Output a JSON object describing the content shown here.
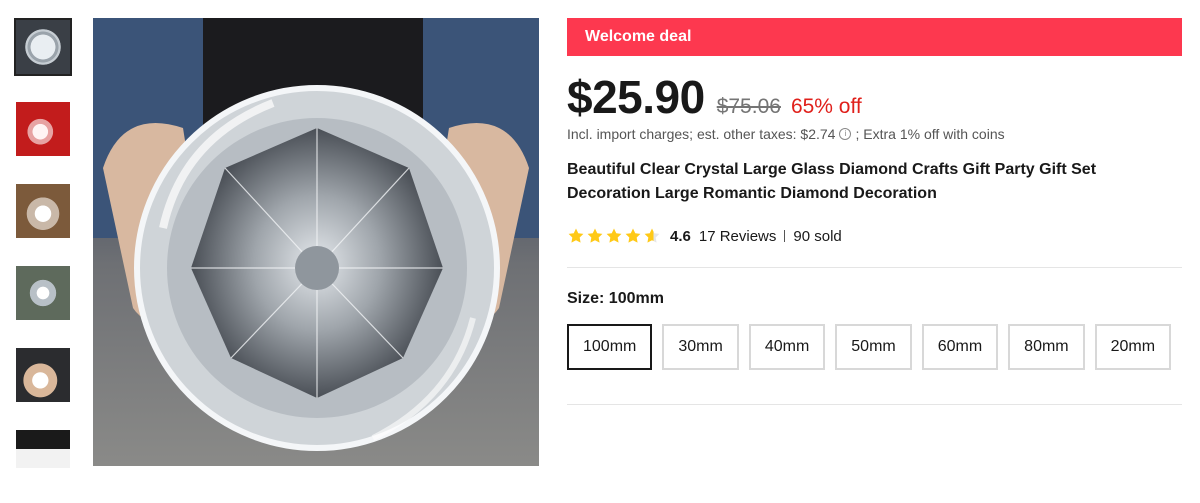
{
  "banner": {
    "label": "Welcome deal",
    "color": "#fd384f"
  },
  "price": {
    "current": "$25.90",
    "original": "$75.06",
    "discount": "65% off"
  },
  "tax_note": {
    "before": "Incl. import charges; est. other taxes: $2.74",
    "info_icon": "info-icon",
    "after": "; Extra 1% off with coins"
  },
  "product": {
    "title": "Beautiful Clear Crystal Large Glass Diamond Crafts Gift Party Gift Set Decoration Large Romantic Diamond Decoration"
  },
  "rating": {
    "score": "4.6",
    "stars_value": 4.6,
    "star_color": "#ffc917",
    "reviews": "17 Reviews",
    "sold": "90 sold"
  },
  "size": {
    "label": "Size: 100mm",
    "options": [
      "100mm",
      "30mm",
      "40mm",
      "50mm",
      "60mm",
      "80mm",
      "20mm"
    ],
    "selected": "100mm"
  },
  "gallery": {
    "thumbnail_count": 6,
    "active_index": 0
  }
}
